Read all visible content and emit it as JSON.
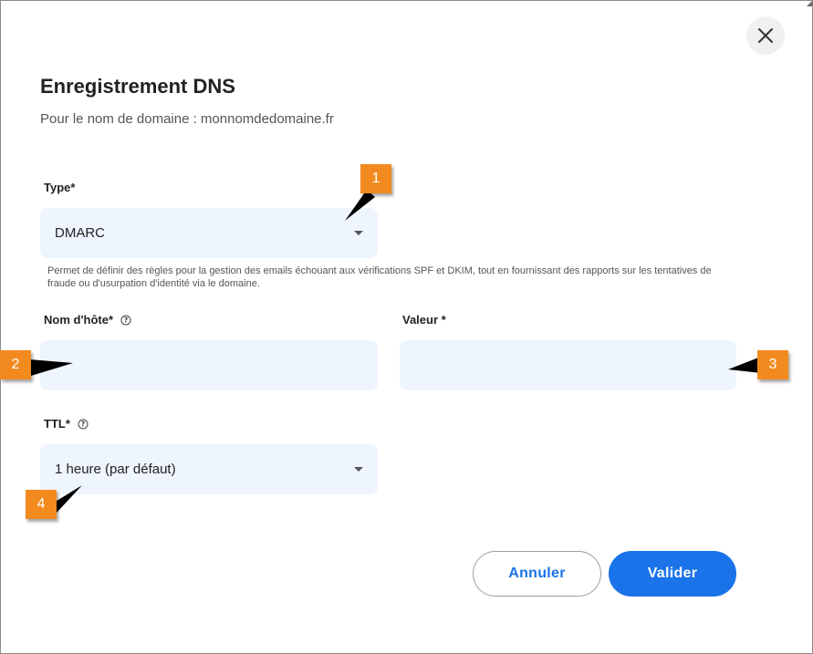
{
  "dialog": {
    "title": "Enregistrement DNS",
    "subtitle": "Pour le nom de domaine : monnomdedomaine.fr",
    "close_icon": "close-icon"
  },
  "form": {
    "type": {
      "label": "Type*",
      "value": "DMARC",
      "description": "Permet de définir des règles pour la gestion des emails échouant aux vérifications SPF et DKIM, tout en fournissant des rapports sur les tentatives de fraude ou d'usurpation d'identité via le domaine."
    },
    "hostname": {
      "label": "Nom d'hôte*",
      "value": ""
    },
    "value": {
      "label": "Valeur *",
      "value": ""
    },
    "ttl": {
      "label": "TTL*",
      "value": "1 heure (par défaut)"
    }
  },
  "actions": {
    "cancel_label": "Annuler",
    "submit_label": "Valider"
  },
  "annotations": {
    "badge_1": "1",
    "badge_2": "2",
    "badge_3": "3",
    "badge_4": "4",
    "color": "#f28a1f"
  },
  "colors": {
    "accent": "#1a73e8",
    "field_bg": "#eef5fe"
  }
}
